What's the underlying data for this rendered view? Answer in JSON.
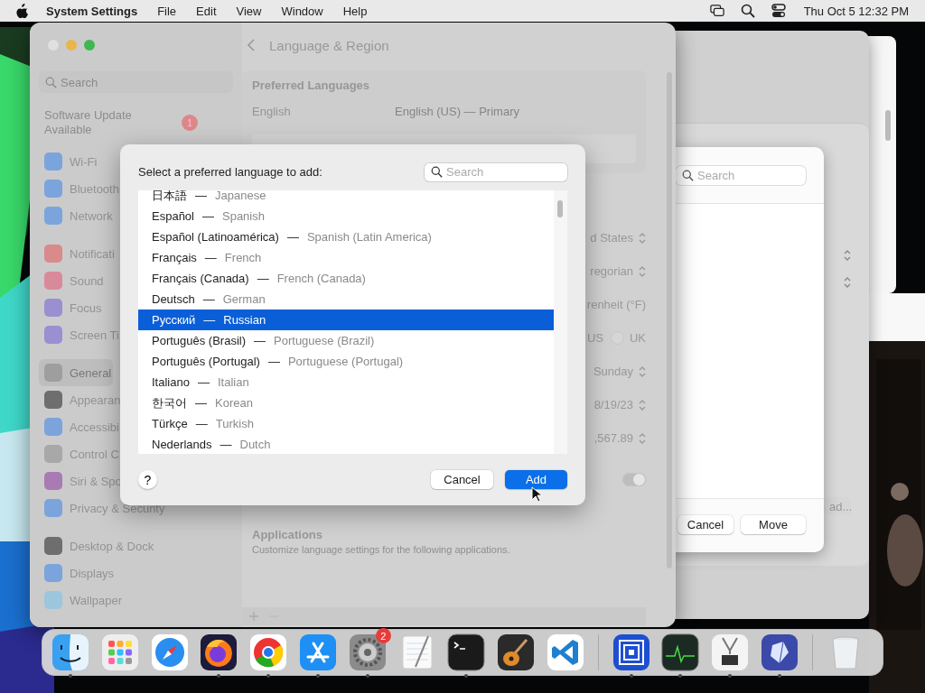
{
  "menubar": {
    "app": "System Settings",
    "menus": [
      "File",
      "Edit",
      "View",
      "Window",
      "Help"
    ],
    "clock": "Thu Oct 5  12:32 PM"
  },
  "settings_window": {
    "title": "Language & Region",
    "search": {
      "placeholder": "Search"
    },
    "update": {
      "label": "Software Update Available",
      "badge": "1"
    },
    "sidebar_groups": [
      [
        {
          "label": "Wi-Fi",
          "color": "#7ba4dc",
          "selected": false
        },
        {
          "label": "Bluetooth",
          "color": "#7ba4dc",
          "selected": false
        },
        {
          "label": "Network",
          "color": "#7ba4dc",
          "selected": false
        }
      ],
      [
        {
          "label": "Notificati",
          "color": "#d98a8a",
          "selected": false
        },
        {
          "label": "Sound",
          "color": "#d98a9a",
          "selected": false
        },
        {
          "label": "Focus",
          "color": "#9a8fd0",
          "selected": false
        },
        {
          "label": "Screen Ti",
          "color": "#9a8fd0",
          "selected": false
        }
      ],
      [
        {
          "label": "General",
          "color": "#9e9e9e",
          "selected": true
        },
        {
          "label": "Appearan",
          "color": "#6e6e6e",
          "selected": false
        },
        {
          "label": "Accessibi",
          "color": "#7ba4dc",
          "selected": false
        },
        {
          "label": "Control C",
          "color": "#a8a8a8",
          "selected": false
        },
        {
          "label": "Siri & Spo",
          "color": "#a87bb4",
          "selected": false
        },
        {
          "label": "Privacy & Security",
          "color": "#7ba4dc",
          "selected": false
        }
      ],
      [
        {
          "label": "Desktop & Dock",
          "color": "#6e6e6e",
          "selected": false
        },
        {
          "label": "Displays",
          "color": "#7ba4dc",
          "selected": false
        },
        {
          "label": "Wallpaper",
          "color": "#9cc6dc",
          "selected": false
        }
      ]
    ],
    "preferred_languages": {
      "title": "Preferred Languages",
      "rows": [
        {
          "name": "English",
          "value": "English (US) — Primary"
        }
      ]
    },
    "region_rows": [
      {
        "kind": "popup",
        "value": "d States"
      },
      {
        "kind": "popup",
        "value": "regorian"
      },
      {
        "kind": "text",
        "value": "renheit (°F)"
      },
      {
        "kind": "radio",
        "value": "US",
        "option": {
          "label": "UK",
          "selected": false
        }
      },
      {
        "kind": "popup",
        "value": "Sunday"
      },
      {
        "kind": "popup",
        "value": "8/19/23"
      },
      {
        "kind": "popup",
        "value": ",567.89"
      },
      {
        "kind": "toggle",
        "on": true
      }
    ],
    "applications": {
      "title": "Applications",
      "subtitle": "Customize language settings for the following applications."
    }
  },
  "language_sheet": {
    "prompt": "Select a preferred language to add:",
    "search": {
      "placeholder": "Search"
    },
    "separator": "—",
    "languages": [
      {
        "native": "日本語",
        "english": "Japanese",
        "selected": false
      },
      {
        "native": "Español",
        "english": "Spanish",
        "selected": false
      },
      {
        "native": "Español (Latinoamérica)",
        "english": "Spanish (Latin America)",
        "selected": false
      },
      {
        "native": "Français",
        "english": "French",
        "selected": false
      },
      {
        "native": "Français (Canada)",
        "english": "French (Canada)",
        "selected": false
      },
      {
        "native": "Deutsch",
        "english": "German",
        "selected": false
      },
      {
        "native": "Русский",
        "english": "Russian",
        "selected": true
      },
      {
        "native": "Português (Brasil)",
        "english": "Portuguese (Brazil)",
        "selected": false
      },
      {
        "native": "Português (Portugal)",
        "english": "Portuguese (Portugal)",
        "selected": false
      },
      {
        "native": "Italiano",
        "english": "Italian",
        "selected": false
      },
      {
        "native": "한국어",
        "english": "Korean",
        "selected": false
      },
      {
        "native": "Türkçe",
        "english": "Turkish",
        "selected": false
      },
      {
        "native": "Nederlands",
        "english": "Dutch",
        "selected": false
      }
    ],
    "help": "?",
    "buttons": [
      {
        "label": "Cancel",
        "kind": "default"
      },
      {
        "label": "Add",
        "kind": "primary"
      }
    ]
  },
  "move_dialog": {
    "search": {
      "placeholder": "Search"
    },
    "buttons": [
      "Cancel",
      "Move"
    ]
  },
  "back_window": {
    "button": "ad..."
  },
  "dock": {
    "items": [
      {
        "kind": "finder",
        "running": true
      },
      {
        "kind": "launchpad",
        "running": false
      },
      {
        "kind": "safari",
        "running": false
      },
      {
        "kind": "firefox",
        "running": true
      },
      {
        "kind": "chrome",
        "running": true
      },
      {
        "kind": "appstore",
        "running": true
      },
      {
        "kind": "settings",
        "running": true,
        "badge": "2"
      },
      {
        "kind": "textedit",
        "running": false
      },
      {
        "kind": "terminal",
        "running": true
      },
      {
        "kind": "guitar",
        "running": false
      },
      {
        "kind": "vscode",
        "running": false
      },
      {
        "kind": "separator"
      },
      {
        "kind": "squares",
        "running": true
      },
      {
        "kind": "monitor",
        "running": true
      },
      {
        "kind": "sysinfo",
        "running": true
      },
      {
        "kind": "gem",
        "running": true
      },
      {
        "kind": "separator"
      },
      {
        "kind": "trash",
        "running": false
      }
    ]
  }
}
